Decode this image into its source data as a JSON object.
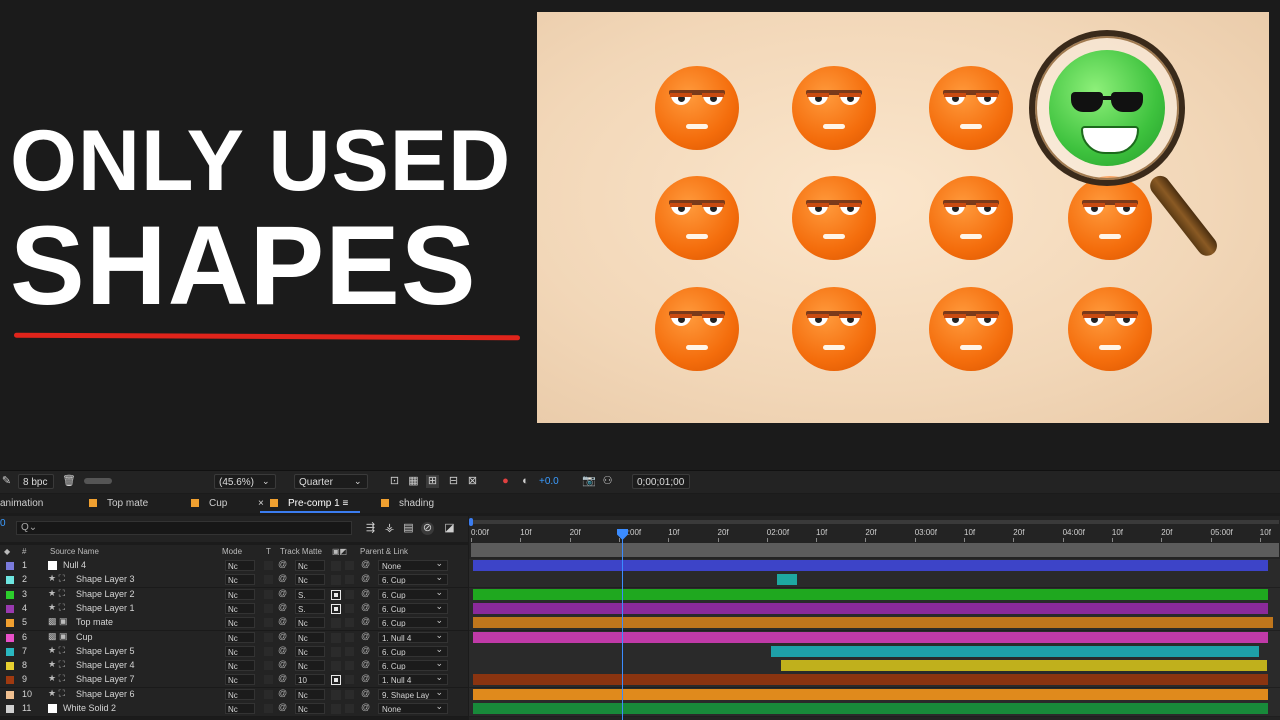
{
  "headline": {
    "line1": "ONLY USED",
    "line2": "SHAPES",
    "underline_color": "#e0241b"
  },
  "preview": {
    "emoji_icon": "orange-unamused-emoji",
    "highlight_icon": "green-sunglasses-emoji",
    "magnifier_icon": "magnifying-glass-icon"
  },
  "toolbar": {
    "bpc": "8 bpc",
    "zoom": "(45.6%)",
    "resolution": "Quarter",
    "exposure": "+0.0",
    "timecode": "0;00;01;00"
  },
  "tabs": [
    {
      "label": "animation",
      "color": ""
    },
    {
      "label": "Top mate",
      "color": "#f0a030"
    },
    {
      "label": "Cup",
      "color": "#f0a030"
    },
    {
      "label": "Pre-comp 1",
      "color": "#f0a030"
    },
    {
      "label": "shading",
      "color": "#f0a030"
    }
  ],
  "search": {
    "current_time": "0",
    "placeholder": "Q⌄"
  },
  "columns": {
    "num": "#",
    "source": "Source Name",
    "mode": "Mode",
    "t": "T",
    "track_matte": "Track Matte",
    "parent": "Parent & Link"
  },
  "layers": [
    {
      "num": "1",
      "name": "Null 4",
      "type": "null",
      "color": "#7b7bdc",
      "mode": "Nc",
      "matte": "Nc",
      "parent": "None",
      "bar_color": "#3d44c8",
      "bar_start": 0.0,
      "bar_end": 0.994
    },
    {
      "num": "2",
      "name": "Shape Layer 3",
      "type": "shape",
      "color": "#6ee6e0",
      "mode": "Nc",
      "matte": "Nc",
      "parent": "6. Cup",
      "bar_color": "#1ea8a0",
      "bar_start": 0.38,
      "bar_end": 0.405
    },
    {
      "num": "3",
      "name": "Shape Layer 2",
      "type": "shape",
      "color": "#2ccf2c",
      "mode": "Nc",
      "matte": "S.",
      "parent": "6. Cup",
      "bar_color": "#1fa81f",
      "bar_start": 0.0,
      "bar_end": 0.994
    },
    {
      "num": "4",
      "name": "Shape Layer 1",
      "type": "shape",
      "color": "#9a3ab0",
      "mode": "Nc",
      "matte": "S.",
      "parent": "6. Cup",
      "bar_color": "#8a2a9a",
      "bar_start": 0.0,
      "bar_end": 0.994
    },
    {
      "num": "5",
      "name": "Top mate",
      "type": "comp",
      "color": "#f0a030",
      "mode": "Nc",
      "matte": "Nc",
      "parent": "6. Cup",
      "bar_color": "#c0761c",
      "bar_start": 0.0,
      "bar_end": 1.0
    },
    {
      "num": "6",
      "name": "Cup",
      "type": "comp",
      "color": "#e850c8",
      "mode": "Nc",
      "matte": "Nc",
      "parent": "1. Null 4",
      "bar_color": "#c03aa8",
      "bar_start": 0.0,
      "bar_end": 0.994
    },
    {
      "num": "7",
      "name": "Shape Layer 5",
      "type": "shape",
      "color": "#2ab8c0",
      "mode": "Nc",
      "matte": "Nc",
      "parent": "6. Cup",
      "bar_color": "#1ea0a8",
      "bar_start": 0.373,
      "bar_end": 0.982
    },
    {
      "num": "8",
      "name": "Shape Layer 4",
      "type": "shape",
      "color": "#e8d030",
      "mode": "Nc",
      "matte": "Nc",
      "parent": "6. Cup",
      "bar_color": "#c0b01c",
      "bar_start": 0.385,
      "bar_end": 0.992
    },
    {
      "num": "9",
      "name": "Shape Layer 7",
      "type": "shape",
      "color": "#a03a10",
      "mode": "Nc",
      "matte": "10",
      "parent": "1. Null 4",
      "bar_color": "#8a3410",
      "bar_start": 0.0,
      "bar_end": 0.994
    },
    {
      "num": "10",
      "name": "Shape Layer 6",
      "type": "shape",
      "color": "#f0c090",
      "mode": "Nc",
      "matte": "Nc",
      "parent": "9. Shape Lay",
      "bar_color": "#e08a1c",
      "bar_start": 0.0,
      "bar_end": 0.994
    },
    {
      "num": "11",
      "name": "White Solid 2",
      "type": "solid",
      "color": "#d0d0d0",
      "mode": "Nc",
      "matte": "Nc",
      "parent": "None",
      "bar_color": "#188a3a",
      "bar_start": 0.0,
      "bar_end": 0.994
    }
  ],
  "ruler": [
    "0:00f",
    "10f",
    "20f",
    "01:00f",
    "10f",
    "20f",
    "02:00f",
    "10f",
    "20f",
    "03:00f",
    "10f",
    "20f",
    "04:00f",
    "10f",
    "20f",
    "05:00f",
    "10f"
  ]
}
